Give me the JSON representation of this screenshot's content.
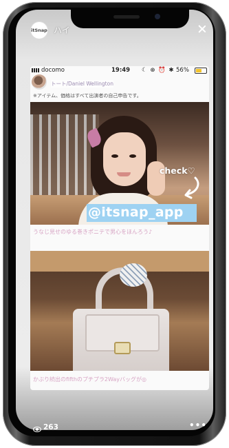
{
  "story": {
    "avatar_label": "itSnap",
    "title": "ハイ",
    "viewer_count": "263",
    "more_label": "•••"
  },
  "inner_status": {
    "carrier": "docomo",
    "time": "19:49",
    "icons": "☾ ⊕ ⏰ ✱",
    "battery_pct": "56%",
    "battery_level": 0.56
  },
  "post": {
    "credit": "トート/Daniel Wellington",
    "note": "※アイテム、価格はすべて出演者の自己申告です。",
    "check_label": "check♡",
    "handle": "@itsnap_app",
    "caption1": "うなじ見せのゆる巻きポニテで男心をほんろう♪",
    "caption2": "かぶり続出のfifthのプチプラ2Wayバッグが◎"
  }
}
